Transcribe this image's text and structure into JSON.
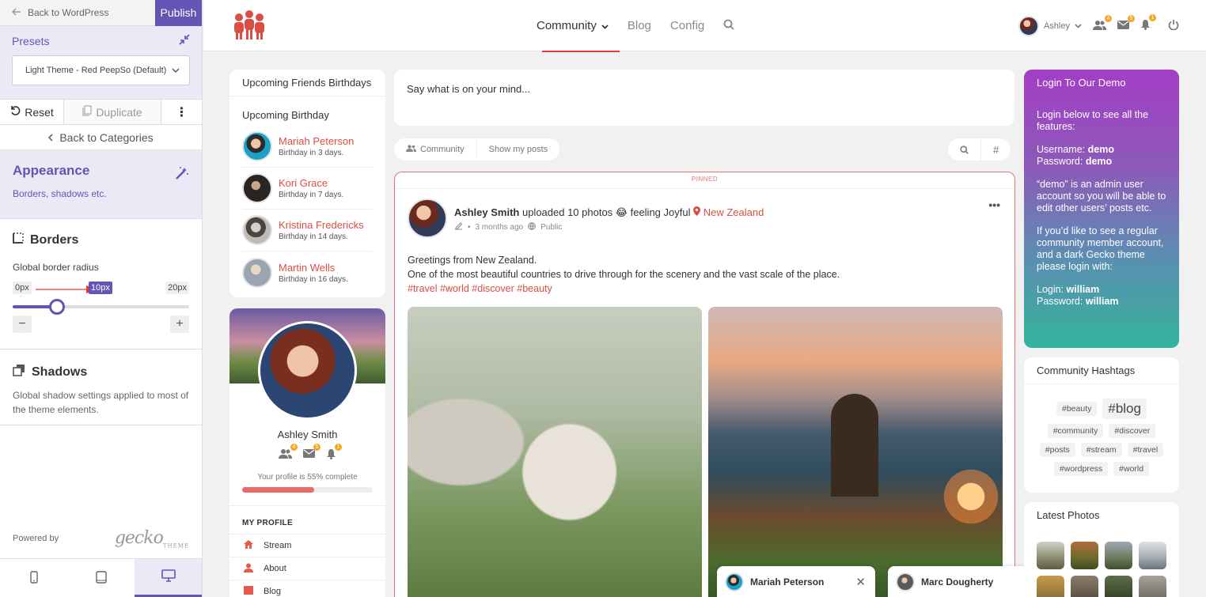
{
  "customizer": {
    "back_label": "Back to WordPress",
    "publish_label": "Publish",
    "presets_title": "Presets",
    "preset_selected": "Light Theme - Red PeepSo (Default)",
    "reset_label": "Reset",
    "duplicate_label": "Duplicate",
    "back_categories_label": "Back to Categories",
    "section_title": "Appearance",
    "section_subtitle": "Borders, shadows etc.",
    "borders_title": "Borders",
    "border_radius_label": "Global border radius",
    "slider": {
      "min_label": "0px",
      "value_label": "10px",
      "max_label": "20px",
      "min": 0,
      "max": 20,
      "value": 10
    },
    "shadows_title": "Shadows",
    "shadows_desc": "Global shadow settings applied to most of the theme elements.",
    "powered_by": "Powered by",
    "brand": "gecko",
    "brand_sub": "THEME",
    "accent_color": "#6355b3"
  },
  "header": {
    "nav": {
      "community": "Community",
      "blog": "Blog",
      "config": "Config"
    },
    "user_name": "Ashley",
    "friends_count": "4",
    "messages_count": "5",
    "notifications_count": "1",
    "accent_color": "#e53935"
  },
  "birthdays": {
    "title": "Upcoming Friends Birthdays",
    "subtitle": "Upcoming Birthday",
    "items": [
      {
        "name": "Mariah Peterson",
        "when": "Birthday in 3 days."
      },
      {
        "name": "Kori Grace",
        "when": "Birthday in 7 days."
      },
      {
        "name": "Kristina Fredericks",
        "when": "Birthday in 14 days."
      },
      {
        "name": "Martin Wells",
        "when": "Birthday in 16 days."
      }
    ]
  },
  "profile": {
    "name": "Ashley Smith",
    "friends_count": "4",
    "messages_count": "5",
    "notifications_count": "1",
    "completion_text": "Your profile is 55% complete",
    "completion": 55,
    "menu_title": "MY PROFILE",
    "menu": [
      {
        "label": "Stream",
        "icon": "home-icon"
      },
      {
        "label": "About",
        "icon": "user-icon"
      },
      {
        "label": "Blog",
        "icon": "blog-icon"
      }
    ]
  },
  "postbox": {
    "placeholder": "Say what is on your mind..."
  },
  "filters": {
    "community": "Community",
    "show_my_posts": "Show my posts"
  },
  "post": {
    "pinned": "PINNED",
    "author": "Ashley Smith",
    "action": " uploaded 10 photos 😂 feeling Joyful ",
    "location": "New Zealand",
    "time": "3 months ago",
    "privacy": "Public",
    "line1": "Greetings from New Zealand.",
    "line2": "One of the most beautiful countries to drive through for the scenery and the vast scale of the place.",
    "hashtags": "#travel #world #discover #beauty"
  },
  "chats": [
    {
      "name": "Mariah Peterson"
    },
    {
      "name": "Marc Dougherty"
    }
  ],
  "login": {
    "title": "Login To Our Demo",
    "intro": "Login below to see all the features:",
    "username_label": "Username:",
    "username": "demo",
    "password_label": "Password:",
    "password": "demo",
    "note1": "“demo” is an admin user account so you will be able to edit other users’ posts etc.",
    "note2": "If you’d like to see a regular community member account, and a dark Gecko theme please login with:",
    "login_label": "Login:",
    "login_user": "william",
    "login_password": "william"
  },
  "hashtags": {
    "title": "Community Hashtags",
    "tags": [
      "#beauty",
      "#blog",
      "#community",
      "#discover",
      "#posts",
      "#stream",
      "#travel",
      "#wordpress",
      "#world"
    ]
  },
  "photos": {
    "title": "Latest Photos"
  }
}
